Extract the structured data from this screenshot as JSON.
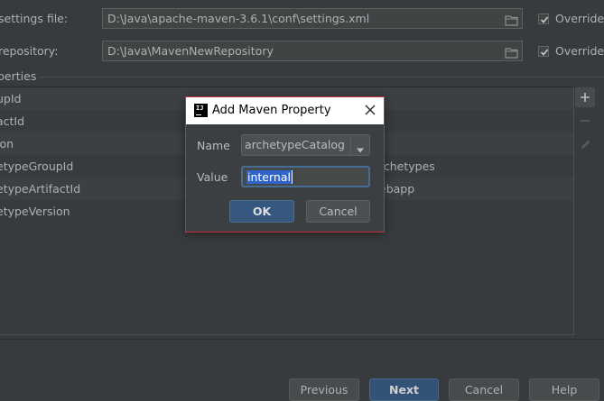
{
  "settings": {
    "settings_file_label": "settings file:",
    "settings_file_value": "D:\\Java\\apache-maven-3.6.1\\conf\\settings.xml",
    "repository_label": "repository:",
    "repository_value": "D:\\Java\\MavenNewRepository",
    "override_label": "Override"
  },
  "properties": {
    "section_title": "perties",
    "rows": [
      {
        "key": "upId",
        "value": ""
      },
      {
        "key": "actId",
        "value": ""
      },
      {
        "key": "ion",
        "value": ""
      },
      {
        "key": "etypeGroupId",
        "value": "rchetypes"
      },
      {
        "key": "etypeArtifactId",
        "value": "ebapp"
      },
      {
        "key": "etypeVersion",
        "value": ""
      }
    ]
  },
  "dialog": {
    "title": "Add Maven Property",
    "name_label": "Name",
    "name_value": "archetypeCatalog",
    "value_label": "Value",
    "value_value": "internal",
    "ok_label": "OK",
    "cancel_label": "Cancel",
    "app_icon_text": "IJ"
  },
  "footer": {
    "previous_label": "Previous",
    "next_label": "Next",
    "cancel_label": "Cancel",
    "help_label": "Help"
  },
  "icons": {
    "folder": "folder-icon",
    "add": "plus-icon",
    "remove": "minus-icon",
    "edit": "pencil-icon",
    "close": "close-icon",
    "dropdown": "chevron-down-icon"
  },
  "colors": {
    "background": "#3c3f41",
    "primary_button": "#365880",
    "dialog_border": "#c5303a",
    "selection": "#2f65ca",
    "focus_ring": "#466d94"
  }
}
